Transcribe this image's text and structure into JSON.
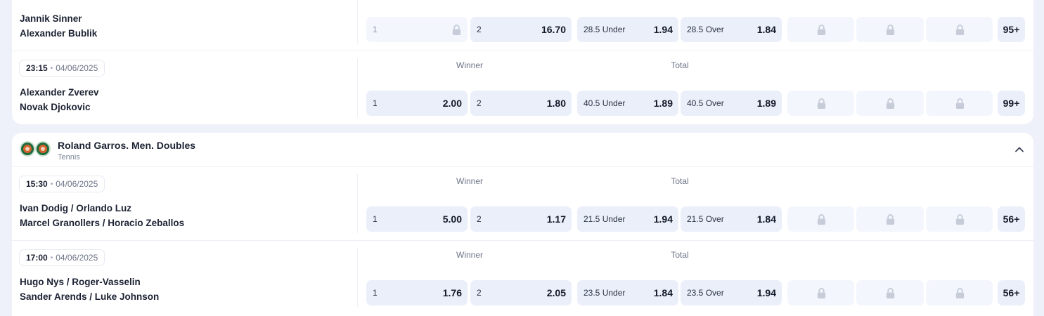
{
  "matches_top": [
    {
      "team1": "Jannik Sinner",
      "team2": "Alexander Bublik",
      "odds": {
        "w1_label": "1",
        "w1_value": "",
        "w2_label": "2",
        "w2_value": "16.70",
        "under_label": "28.5 Under",
        "under_value": "1.94",
        "over_label": "28.5 Over",
        "over_value": "1.84",
        "more": "95+"
      }
    },
    {
      "time": "23:15",
      "date": "04/06/2025",
      "winner_header": "Winner",
      "total_header": "Total",
      "team1": "Alexander Zverev",
      "team2": "Novak Djokovic",
      "odds": {
        "w1_label": "1",
        "w1_value": "2.00",
        "w2_label": "2",
        "w2_value": "1.80",
        "under_label": "40.5 Under",
        "under_value": "1.89",
        "over_label": "40.5 Over",
        "over_value": "1.89",
        "more": "99+"
      }
    }
  ],
  "tournament": {
    "title": "Roland Garros. Men. Doubles",
    "sport": "Tennis",
    "logo_icon": "roland-garros-logo",
    "collapse_icon": "chevron-up-icon"
  },
  "matches_doubles": [
    {
      "time": "15:30",
      "date": "04/06/2025",
      "winner_header": "Winner",
      "total_header": "Total",
      "team1": "Ivan Dodig / Orlando Luz",
      "team2": "Marcel Granollers / Horacio Zeballos",
      "odds": {
        "w1_label": "1",
        "w1_value": "5.00",
        "w2_label": "2",
        "w2_value": "1.17",
        "under_label": "21.5 Under",
        "under_value": "1.94",
        "over_label": "21.5 Over",
        "over_value": "1.84",
        "more": "56+"
      }
    },
    {
      "time": "17:00",
      "date": "04/06/2025",
      "winner_header": "Winner",
      "total_header": "Total",
      "team1": "Hugo Nys / Roger-Vasselin",
      "team2": "Sander Arends / Luke Johnson",
      "odds": {
        "w1_label": "1",
        "w1_value": "1.76",
        "w2_label": "2",
        "w2_value": "2.05",
        "under_label": "23.5 Under",
        "under_value": "1.84",
        "over_label": "23.5 Over",
        "over_value": "1.94",
        "more": "56+"
      }
    }
  ],
  "separator_dot": "•",
  "lock_icon": "lock-icon",
  "colors": {
    "page_bg": "#eef1f9",
    "card_bg": "#ffffff",
    "odd_bg": "#ebeffa",
    "locked_bg": "#f3f6fc",
    "text": "#1c2233"
  }
}
